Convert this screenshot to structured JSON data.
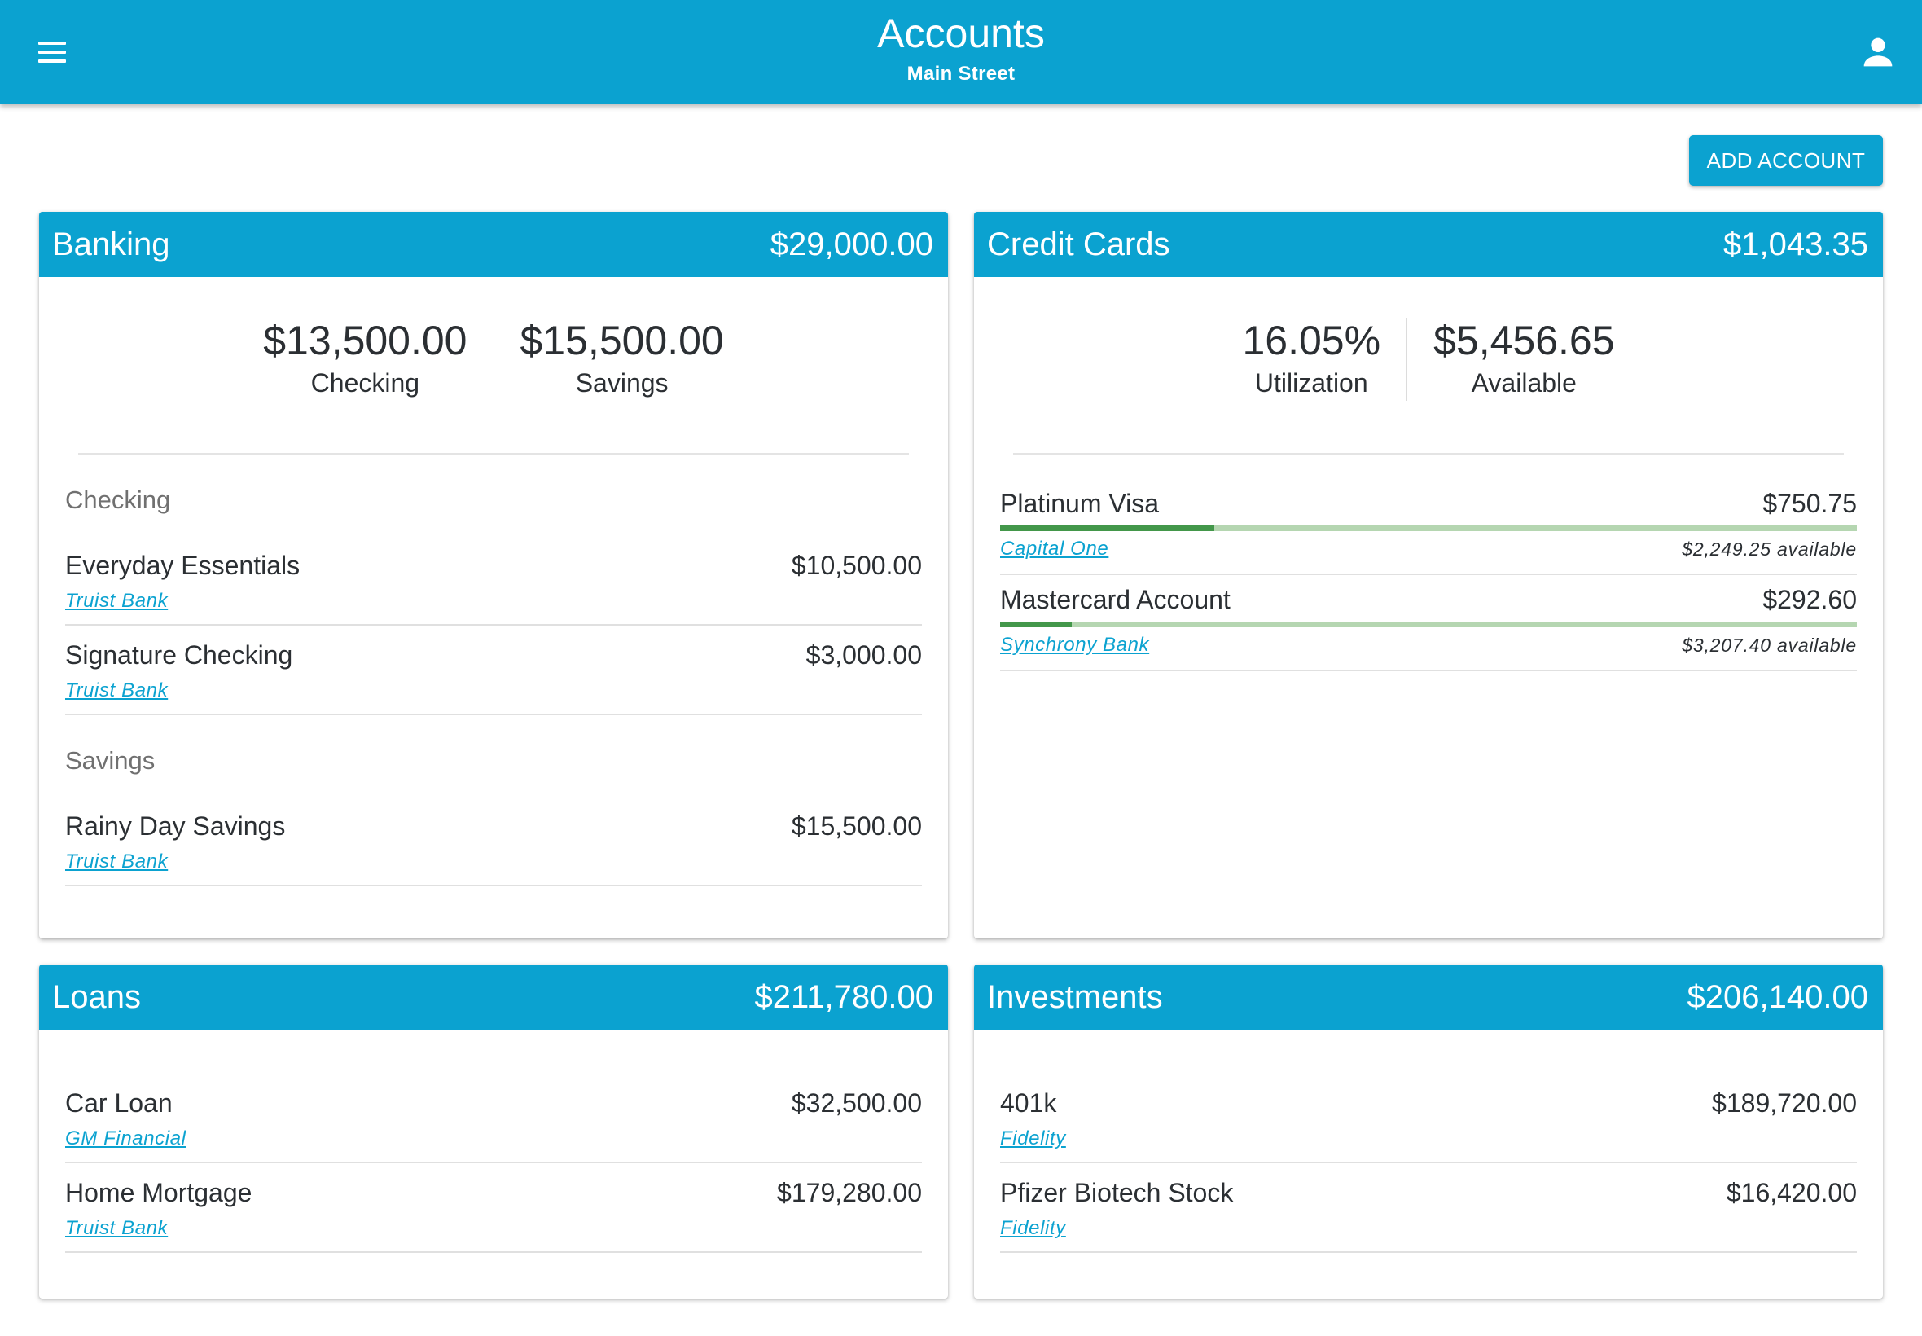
{
  "header": {
    "title": "Accounts",
    "subtitle": "Main Street",
    "menu_icon": "menu-icon",
    "user_icon": "account-icon"
  },
  "actions": {
    "add_account": "ADD ACCOUNT"
  },
  "colors": {
    "primary": "#0ba2d0",
    "bar_fill": "#43974a",
    "bar_track": "#b5d6b1"
  },
  "banking": {
    "title": "Banking",
    "total": "$29,000.00",
    "summary": [
      {
        "value": "$13,500.00",
        "label": "Checking"
      },
      {
        "value": "$15,500.00",
        "label": "Savings"
      }
    ],
    "groups": [
      {
        "label": "Checking",
        "accounts": [
          {
            "name": "Everyday Essentials",
            "amount": "$10,500.00",
            "bank": "Truist Bank"
          },
          {
            "name": "Signature Checking",
            "amount": "$3,000.00",
            "bank": "Truist Bank"
          }
        ]
      },
      {
        "label": "Savings",
        "accounts": [
          {
            "name": "Rainy Day Savings",
            "amount": "$15,500.00",
            "bank": "Truist Bank"
          }
        ]
      }
    ]
  },
  "credit_cards": {
    "title": "Credit Cards",
    "total": "$1,043.35",
    "summary": [
      {
        "value": "16.05%",
        "label": "Utilization"
      },
      {
        "value": "$5,456.65",
        "label": "Available"
      }
    ],
    "accounts": [
      {
        "name": "Platinum Visa",
        "amount": "$750.75",
        "bank": "Capital One",
        "available": "$2,249.25 available",
        "utilization": 0.25
      },
      {
        "name": "Mastercard Account",
        "amount": "$292.60",
        "bank": "Synchrony Bank",
        "available": "$3,207.40 available",
        "utilization": 0.084
      }
    ]
  },
  "loans": {
    "title": "Loans",
    "total": "$211,780.00",
    "accounts": [
      {
        "name": "Car Loan",
        "amount": "$32,500.00",
        "bank": "GM Financial"
      },
      {
        "name": "Home Mortgage",
        "amount": "$179,280.00",
        "bank": "Truist Bank"
      }
    ]
  },
  "investments": {
    "title": "Investments",
    "total": "$206,140.00",
    "accounts": [
      {
        "name": "401k",
        "amount": "$189,720.00",
        "bank": "Fidelity"
      },
      {
        "name": "Pfizer Biotech Stock",
        "amount": "$16,420.00",
        "bank": "Fidelity"
      }
    ]
  }
}
